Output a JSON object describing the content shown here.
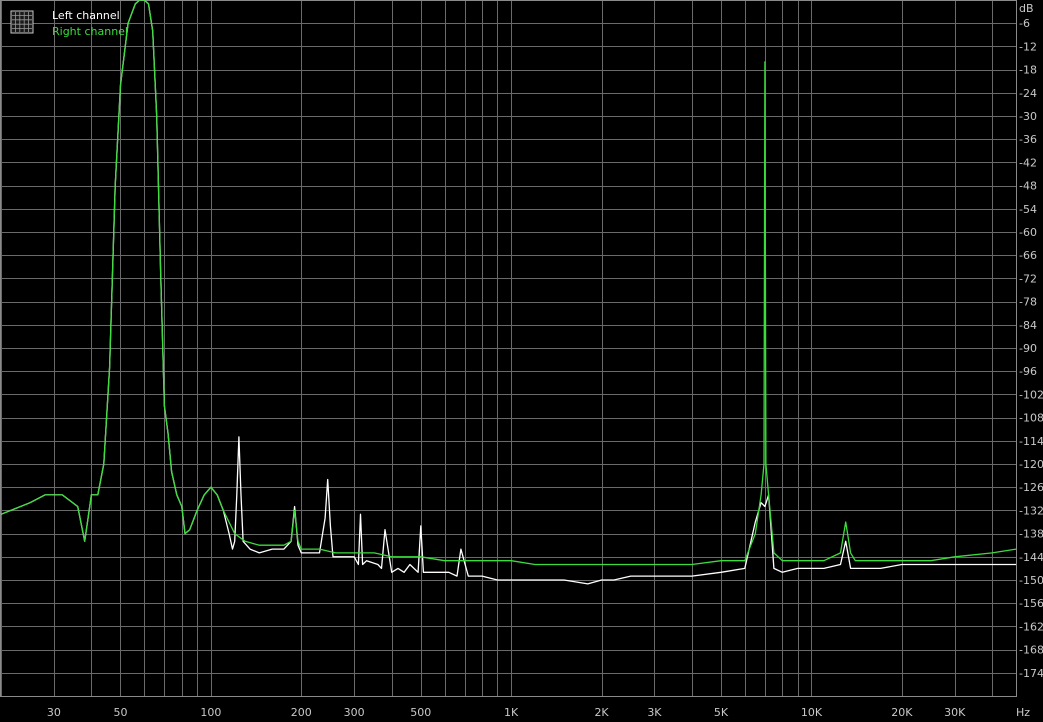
{
  "chart_data": {
    "type": "line",
    "xscale": "log",
    "xlim": [
      20,
      48000
    ],
    "ylim": [
      -180,
      0
    ],
    "grid": true,
    "legend_position": "top-left",
    "x_unit": "Hz",
    "y_unit": "dB",
    "x_ticks": [
      {
        "value": 30,
        "label": "30"
      },
      {
        "value": 50,
        "label": "50"
      },
      {
        "value": 100,
        "label": "100"
      },
      {
        "value": 200,
        "label": "200"
      },
      {
        "value": 300,
        "label": "300"
      },
      {
        "value": 500,
        "label": "500"
      },
      {
        "value": 1000,
        "label": "1K"
      },
      {
        "value": 2000,
        "label": "2K"
      },
      {
        "value": 3000,
        "label": "3K"
      },
      {
        "value": 5000,
        "label": "5K"
      },
      {
        "value": 10000,
        "label": "10K"
      },
      {
        "value": 20000,
        "label": "20K"
      },
      {
        "value": 30000,
        "label": "30K"
      }
    ],
    "y_ticks": [
      -6,
      -12,
      -18,
      -24,
      -30,
      -36,
      -42,
      -48,
      -54,
      -60,
      -66,
      -72,
      -78,
      -84,
      -90,
      -96,
      -102,
      -108,
      -114,
      -120,
      -126,
      -132,
      -138,
      -144,
      -150,
      -156,
      -162,
      -168,
      -174
    ],
    "series": [
      {
        "name": "Left channel",
        "color": "#ffffff",
        "x": [
          20,
          25,
          28,
          32,
          36,
          38,
          40,
          42,
          44,
          46,
          48,
          50,
          53,
          56,
          58,
          60,
          62,
          64,
          66,
          68,
          70,
          72,
          74,
          77,
          80,
          82,
          85,
          90,
          95,
          100,
          105,
          110,
          115,
          118,
          120,
          122,
          124,
          126,
          128,
          135,
          145,
          160,
          175,
          185,
          190,
          195,
          200,
          210,
          230,
          240,
          245,
          250,
          255,
          260,
          270,
          300,
          310,
          315,
          320,
          330,
          360,
          370,
          380,
          400,
          420,
          440,
          460,
          490,
          500,
          510,
          520,
          560,
          620,
          660,
          680,
          720,
          800,
          900,
          1000,
          1200,
          1500,
          1800,
          2000,
          2200,
          2500,
          3000,
          4000,
          5000,
          6000,
          6500,
          6800,
          7000,
          7200,
          7500,
          8000,
          9000,
          11000,
          12500,
          13000,
          13500,
          14000,
          15000,
          17000,
          20000,
          25000,
          30000,
          40000,
          48000
        ],
        "y": [
          -133,
          -130,
          -128,
          -128,
          -131,
          -140,
          -128,
          -128,
          -120,
          -95,
          -48,
          -22,
          -6,
          -1,
          0,
          0,
          -1,
          -8,
          -30,
          -70,
          -105,
          -112,
          -122,
          -128,
          -131,
          -138,
          -137,
          -132,
          -128,
          -126,
          -128,
          -132,
          -138,
          -142,
          -140,
          -128,
          -113,
          -128,
          -140,
          -142,
          -143,
          -142,
          -142,
          -140,
          -131,
          -141,
          -143,
          -143,
          -143,
          -134,
          -124,
          -136,
          -144,
          -144,
          -144,
          -144,
          -146,
          -133,
          -146,
          -145,
          -146,
          -147,
          -137,
          -148,
          -147,
          -148,
          -146,
          -148,
          -136,
          -148,
          -148,
          -148,
          -148,
          -149,
          -142,
          -149,
          -149,
          -150,
          -150,
          -150,
          -150,
          -151,
          -150,
          -150,
          -149,
          -149,
          -149,
          -148,
          -147,
          -135,
          -130,
          -131,
          -128,
          -147,
          -148,
          -147,
          -147,
          -146,
          -140,
          -147,
          -147,
          -147,
          -147,
          -146,
          -146,
          -146,
          -146,
          -146
        ]
      },
      {
        "name": "Right channel",
        "color": "#3cdc3c",
        "x": [
          20,
          25,
          28,
          32,
          36,
          38,
          40,
          42,
          44,
          46,
          48,
          50,
          53,
          56,
          58,
          60,
          62,
          64,
          66,
          68,
          70,
          72,
          74,
          77,
          80,
          82,
          85,
          90,
          95,
          100,
          105,
          110,
          120,
          130,
          145,
          160,
          175,
          185,
          190,
          195,
          200,
          210,
          230,
          260,
          300,
          350,
          400,
          450,
          500,
          600,
          700,
          800,
          900,
          1000,
          1200,
          1500,
          2000,
          2500,
          3000,
          4000,
          5000,
          6000,
          6500,
          6800,
          6950,
          7000,
          7050,
          7200,
          7500,
          8000,
          9000,
          11000,
          12500,
          13000,
          13500,
          14000,
          15000,
          17000,
          20000,
          25000,
          30000,
          40000,
          48000
        ],
        "y": [
          -133,
          -130,
          -128,
          -128,
          -131,
          -140,
          -128,
          -128,
          -120,
          -95,
          -48,
          -22,
          -6,
          -1,
          0,
          0,
          -1,
          -8,
          -30,
          -70,
          -105,
          -112,
          -122,
          -128,
          -131,
          -138,
          -137,
          -132,
          -128,
          -126,
          -128,
          -132,
          -138,
          -140,
          -141,
          -141,
          -141,
          -140,
          -132,
          -140,
          -142,
          -142,
          -142,
          -143,
          -143,
          -143,
          -144,
          -144,
          -144,
          -145,
          -145,
          -145,
          -145,
          -145,
          -146,
          -146,
          -146,
          -146,
          -146,
          -146,
          -145,
          -145,
          -138,
          -128,
          -120,
          -16,
          -120,
          -128,
          -143,
          -145,
          -145,
          -145,
          -143,
          -135,
          -143,
          -145,
          -145,
          -145,
          -145,
          -145,
          -144,
          -143,
          -142
        ]
      }
    ]
  }
}
